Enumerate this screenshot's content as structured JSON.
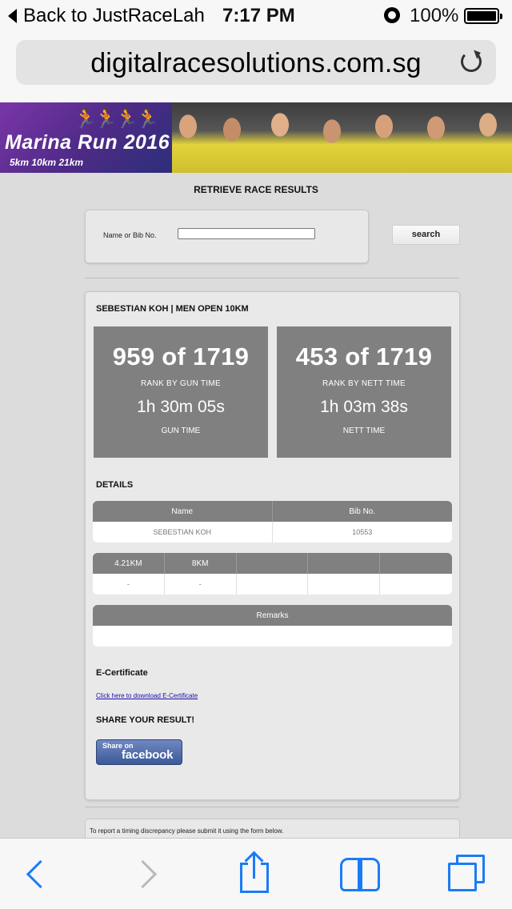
{
  "status_bar": {
    "back_app": "Back to JustRaceLah",
    "time": "7:17 PM",
    "battery": "100%"
  },
  "browser": {
    "url": "digitalracesolutions.com.sg"
  },
  "banner": {
    "title": "Marina Run 2016",
    "subtitle": "5km 10km 21km"
  },
  "search": {
    "heading": "RETRIEVE RACE RESULTS",
    "label": "Name or Bib No.",
    "value": "",
    "button_label": "search"
  },
  "result": {
    "heading": "SEBESTIAN KOH | MEN OPEN 10KM",
    "gun": {
      "rank": "959 of 1719",
      "rank_label": "RANK BY GUN TIME",
      "time": "1h 30m 05s",
      "time_label": "GUN TIME"
    },
    "nett": {
      "rank": "453 of 1719",
      "rank_label": "RANK BY NETT TIME",
      "time": "1h 03m 38s",
      "time_label": "NETT TIME"
    },
    "details_heading": "DETAILS",
    "details_table": {
      "headers": [
        "Name",
        "Bib No."
      ],
      "row": [
        "SEBESTIAN KOH",
        "10553"
      ]
    },
    "splits_table": {
      "headers": [
        "4.21KM",
        "8KM",
        "",
        "",
        ""
      ],
      "row": [
        "-",
        "-",
        "",
        "",
        ""
      ]
    },
    "remarks_table": {
      "header": "Remarks",
      "value": ""
    },
    "ecert_heading": "E-Certificate",
    "ecert_link": "Click here to download E-Certificate",
    "share_heading": "SHARE YOUR RESULT!",
    "facebook": {
      "small": "Share on",
      "big": "facebook"
    }
  },
  "report": {
    "text": "To report a timing discrepancy please submit it using the form below."
  },
  "colors": {
    "rank_box": "#808080",
    "ios_blue": "#1a7cf5",
    "facebook_blue": "#3b5998"
  }
}
